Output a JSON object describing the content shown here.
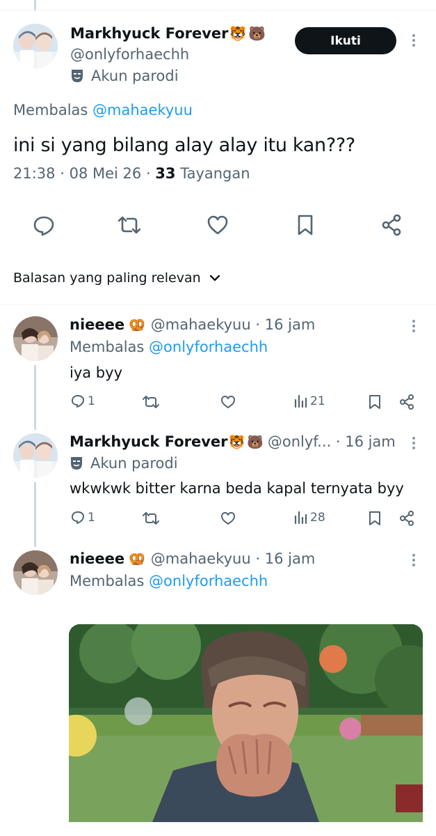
{
  "main_tweet": {
    "display_name": "Markhyuck Forever",
    "name_emojis": [
      "🐯",
      "🐻"
    ],
    "handle": "@onlyforhaechh",
    "parody_label": "Akun parodi",
    "follow_label": "Ikuti",
    "reply_prefix": "Membalas",
    "reply_to": "@mahaekyuu",
    "text": "ini si yang bilang alay alay itu kan???",
    "time": "21:38",
    "date": "08 Mei 26",
    "views_count": "33",
    "views_label": "Tayangan"
  },
  "sort_label": "Balasan yang paling relevan",
  "replies": [
    {
      "display_name": "nieeee",
      "name_emoji": "🥨",
      "handle": "@mahaekyuu",
      "time": "16 jam",
      "reply_prefix": "Membalas",
      "reply_to": "@onlyforhaechh",
      "text": "iya byy",
      "reply_count": "1",
      "views": "21"
    },
    {
      "display_name": "Markhyuck Forever",
      "name_emojis": [
        "🐯",
        "🐻"
      ],
      "handle": "@onlyf...",
      "time": "16 jam",
      "parody_label": "Akun parodi",
      "text": "wkwkwk bitter karna beda kapal ternyata byy",
      "reply_count": "1",
      "views": "28"
    },
    {
      "display_name": "nieeee",
      "name_emoji": "🥨",
      "handle": "@mahaekyuu",
      "time": "16 jam",
      "reply_prefix": "Membalas",
      "reply_to": "@onlyforhaechh",
      "media": "gif-laughing-man"
    }
  ],
  "colors": {
    "link": "#1d9bf0",
    "muted": "#536471",
    "text": "#0f1419",
    "follow_bg": "#0f1419"
  }
}
